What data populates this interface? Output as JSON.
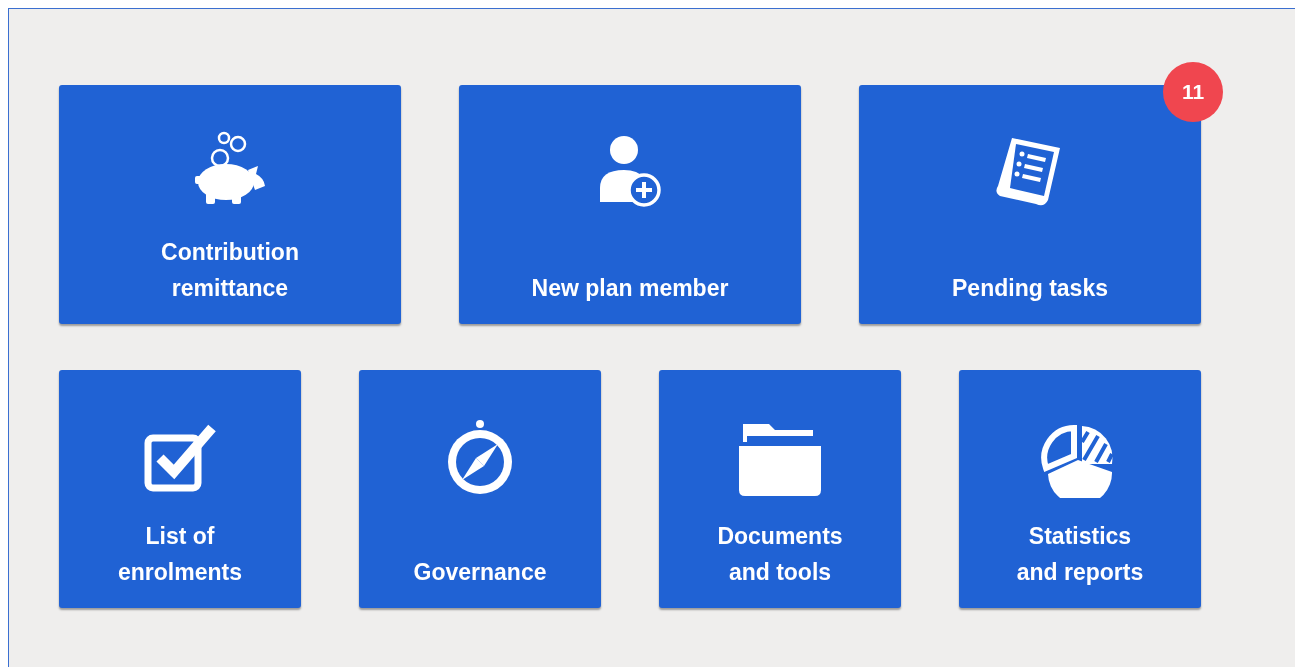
{
  "rows": [
    {
      "tiles": [
        {
          "label": "Contribution\nremittance"
        },
        {
          "label": "New plan member"
        },
        {
          "label": "Pending tasks",
          "badge": "11"
        }
      ]
    },
    {
      "tiles": [
        {
          "label": "List of\nenrolments"
        },
        {
          "label": "Governance"
        },
        {
          "label": "Documents\nand tools"
        },
        {
          "label": "Statistics\nand reports"
        }
      ]
    }
  ]
}
